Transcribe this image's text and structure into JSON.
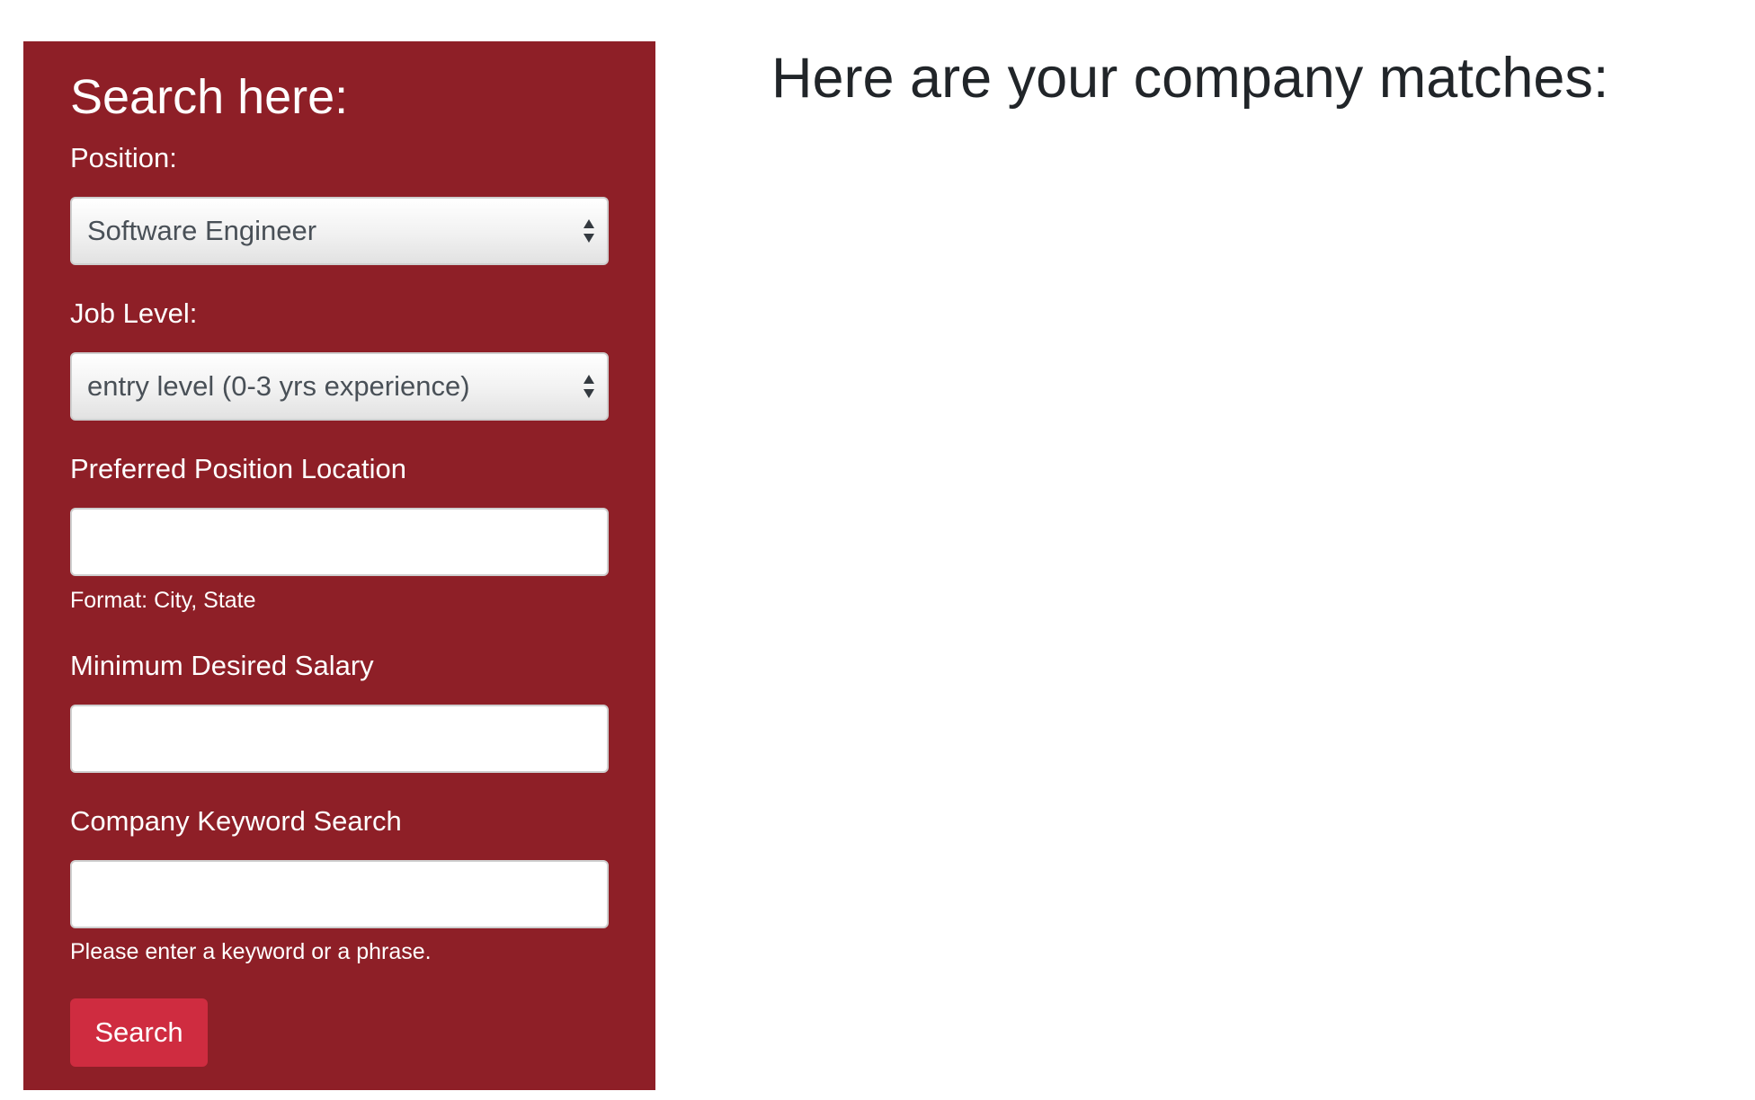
{
  "sidebar": {
    "title": "Search here:",
    "background_color": "#8e1f27",
    "position": {
      "label": "Position:",
      "selected": "Software Engineer"
    },
    "job_level": {
      "label": "Job Level:",
      "selected": "entry level (0-3 yrs experience)"
    },
    "location": {
      "label": "Preferred Position Location",
      "value": "",
      "help": "Format: City, State"
    },
    "salary": {
      "label": "Minimum Desired Salary",
      "value": ""
    },
    "keyword": {
      "label": "Company Keyword Search",
      "value": "",
      "help": "Please enter a keyword or a phrase."
    },
    "search_button": {
      "label": "Search",
      "color": "#cf2c40"
    }
  },
  "main": {
    "title": "Here are your company matches:",
    "results": []
  }
}
